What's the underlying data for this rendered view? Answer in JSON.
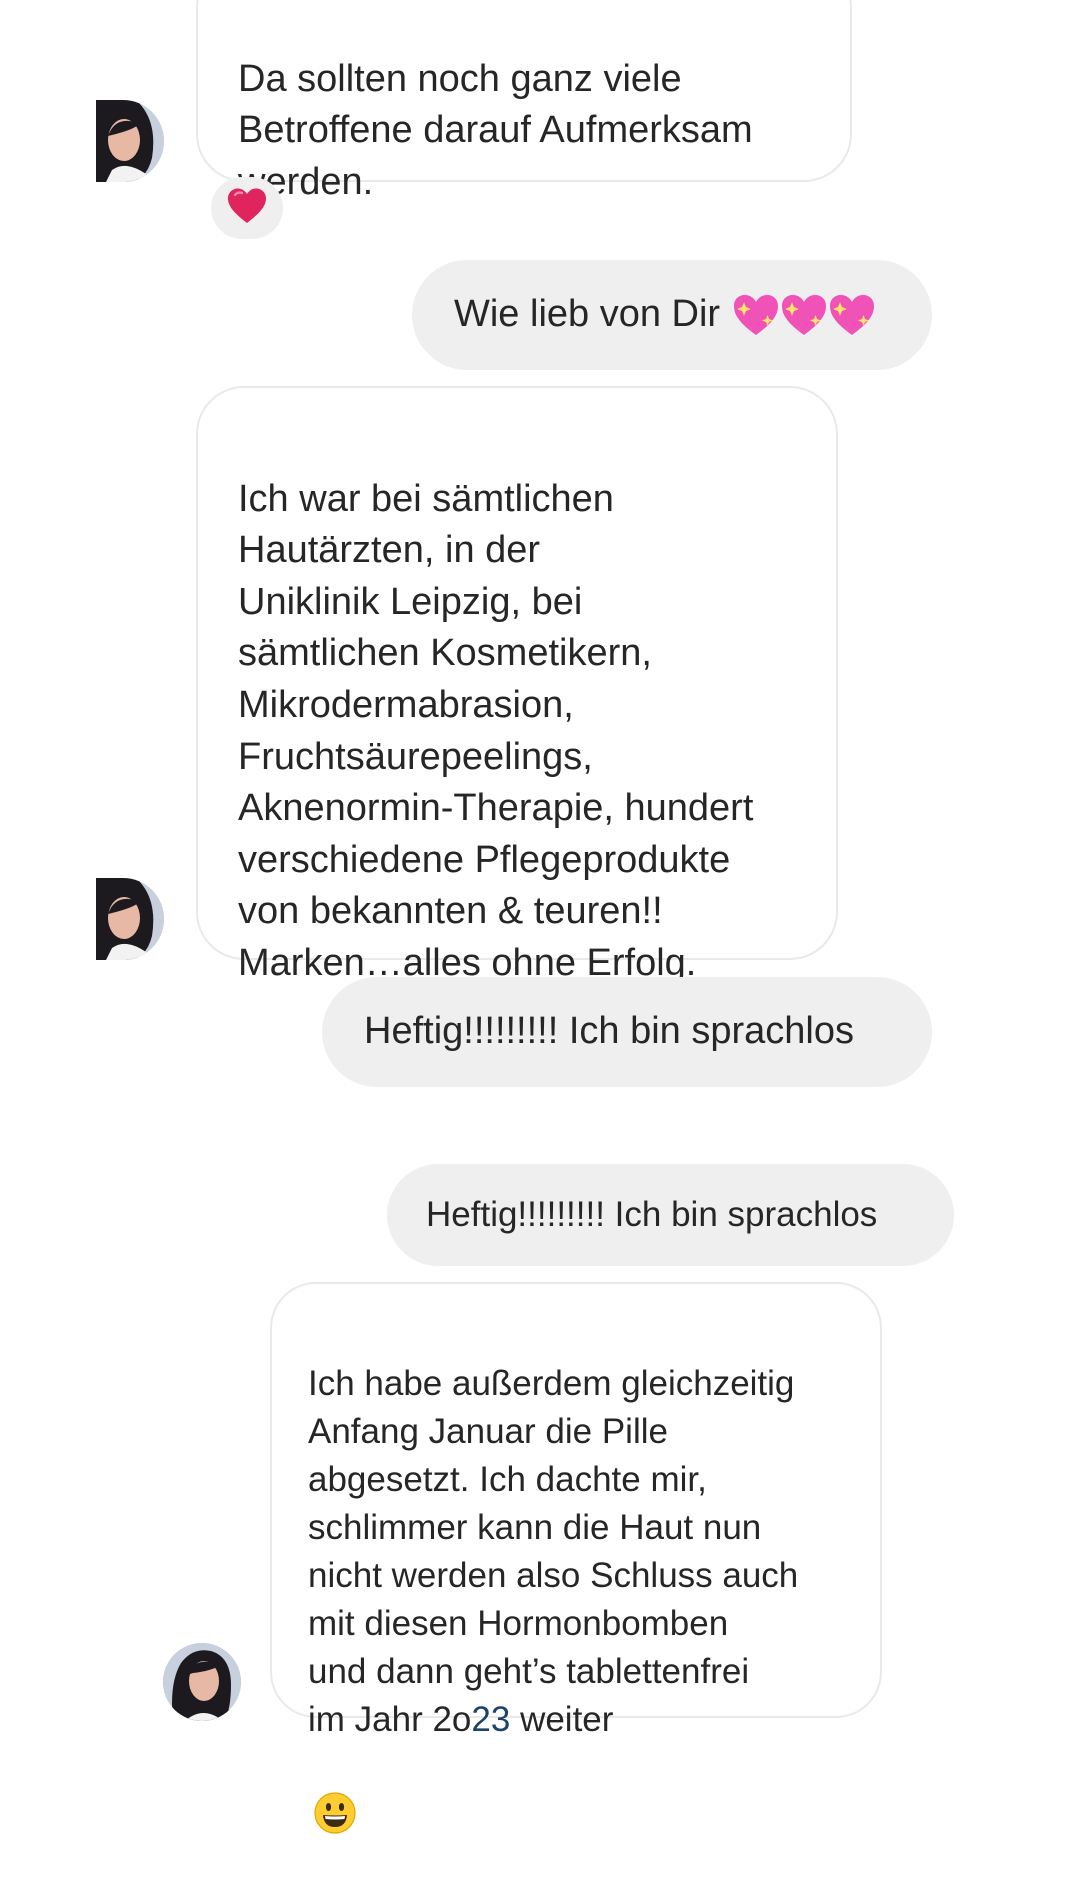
{
  "messages": [
    {
      "id": "m1",
      "direction": "incoming",
      "text": "Da sollten noch ganz viele\nBetroffene darauf Aufmerksam\nwerden.",
      "reaction": "heart"
    },
    {
      "id": "m2",
      "direction": "outgoing",
      "text": "Wie lieb von Dir",
      "emojis": [
        "sparkling-heart-icon",
        "sparkling-heart-icon",
        "sparkling-heart-icon"
      ]
    },
    {
      "id": "m3",
      "direction": "incoming",
      "text": "Ich war bei sämtlichen\nHautärzten, in der\nUniklinik Leipzig, bei\nsämtlichen Kosmetikern,\nMikrodermabrasion,\nFruchtsäurepeelings,\nAknenormin-Therapie, hundert\nverschiedene Pflegeprodukte\nvon bekannten & teuren!!\nMarken…alles ohne Erfolg."
    },
    {
      "id": "m4",
      "direction": "outgoing",
      "text": "Heftig!!!!!!!!! Ich bin sprachlos"
    },
    {
      "id": "m5",
      "direction": "outgoing",
      "text": "Heftig!!!!!!!!! Ich bin sprachlos"
    },
    {
      "id": "m6",
      "direction": "incoming",
      "text_main": "Ich habe außerdem gleichzeitig\nAnfang Januar die Pille\nabgesetzt. Ich dachte mir,\nschlimmer kann die Haut nun\nnicht werden also Schluss auch\nmit diesen Hormonbomben\nund dann geht’s tablettenfrei\nim Jahr 2o",
      "text_link": "23",
      "text_end": " weiter",
      "emoji": "grinning-face-icon"
    }
  ],
  "colors": {
    "incoming_bg": "#ffffff",
    "incoming_border": "#e9e9e9",
    "outgoing_bg": "#efefef",
    "text": "#262626",
    "link": "#1c4466",
    "heart": "#e0245e"
  }
}
